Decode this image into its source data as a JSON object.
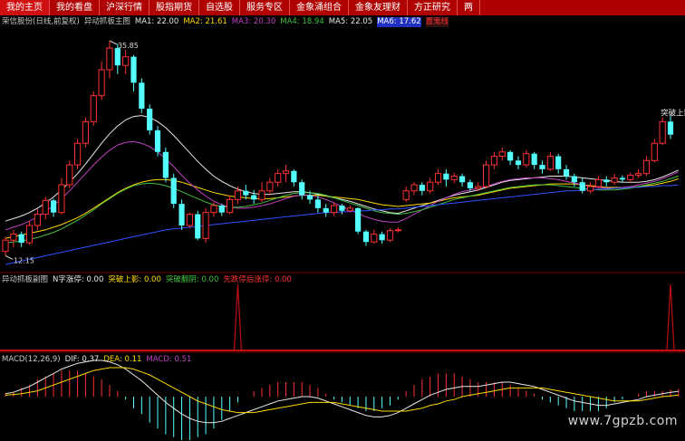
{
  "tabs": [
    "我的主页",
    "我的看盘",
    "沪深行情",
    "股指期货",
    "自选股",
    "服务专区",
    "金象涌组合",
    "金象友理财",
    "方正研究",
    "两"
  ],
  "main_legend": {
    "stock": "荣信股份(日线,前复权)",
    "indicator": "异动抓板主图",
    "ma1": "MA1: 22.00",
    "ma2": "MA2: 21.61",
    "ma3": "MA3: 20.30",
    "ma4": "MA4: 18.94",
    "ma5": "MA5: 22.05",
    "ma6": "MA6: 17.62",
    "extra": "置鬼线"
  },
  "price_high_label": "35.85",
  "price_low_label": "12.15",
  "break_label": "突破上影",
  "sub1_legend": {
    "name": "异动抓板副图",
    "n_item": "N字涨停: 0.00",
    "break_item": "突破上影: 0.00",
    "break_ok": "突破翻阴: 0.00",
    "lure": "先跌停后涨停: 0.00"
  },
  "macd_legend": {
    "name": "MACD(12,26,9)",
    "dif": "DIF: 0.37",
    "dea": "DEA: 0.11",
    "macd": "MACD: 0.51"
  },
  "watermark": "www.7gpzb.com",
  "colors": {
    "topbar": "#b00000",
    "up": "#ff3030",
    "down": "#54ffff",
    "ma_white": "#e8e8e8",
    "ma_yellow": "#ffd700",
    "ma_magenta": "#c040c0",
    "ma_green": "#40c040",
    "ma_blue": "#3050ff",
    "signal_line": "#c01010"
  },
  "candles": [
    [
      11.5,
      12.8,
      11.0,
      13.2
    ],
    [
      12.8,
      13.5,
      12.0,
      14.0
    ],
    [
      13.5,
      12.5,
      12.0,
      13.8
    ],
    [
      12.5,
      14.5,
      12.3,
      15.0
    ],
    [
      14.5,
      15.8,
      14.0,
      16.4
    ],
    [
      15.8,
      17.4,
      15.2,
      17.8
    ],
    [
      17.4,
      16.0,
      15.5,
      17.6
    ],
    [
      16.0,
      19.2,
      15.8,
      20.0
    ],
    [
      19.2,
      21.5,
      18.8,
      22.0
    ],
    [
      21.5,
      24.0,
      21.0,
      24.5
    ],
    [
      24.0,
      26.5,
      23.5,
      27.0
    ],
    [
      26.5,
      29.5,
      26.0,
      30.0
    ],
    [
      29.5,
      32.5,
      29.0,
      33.5
    ],
    [
      32.5,
      35.0,
      31.5,
      35.85
    ],
    [
      35.0,
      33.0,
      32.0,
      35.5
    ],
    [
      33.0,
      34.0,
      32.0,
      34.8
    ],
    [
      34.0,
      31.0,
      30.0,
      34.2
    ],
    [
      31.0,
      28.0,
      27.5,
      31.5
    ],
    [
      28.0,
      25.5,
      25.0,
      28.5
    ],
    [
      25.5,
      23.0,
      22.5,
      26.0
    ],
    [
      23.0,
      20.0,
      19.5,
      23.5
    ],
    [
      20.0,
      17.0,
      16.5,
      20.5
    ],
    [
      17.0,
      14.5,
      14.0,
      17.5
    ],
    [
      14.5,
      15.8,
      14.2,
      16.0
    ],
    [
      15.8,
      13.0,
      12.8,
      16.2
    ],
    [
      13.0,
      16.0,
      12.5,
      16.5
    ],
    [
      16.0,
      16.8,
      15.5,
      17.2
    ],
    [
      16.8,
      16.0,
      15.6,
      17.0
    ],
    [
      16.0,
      17.5,
      15.8,
      18.0
    ],
    [
      17.5,
      18.5,
      17.0,
      19.0
    ],
    [
      18.5,
      18.0,
      17.5,
      19.2
    ],
    [
      18.0,
      17.5,
      17.0,
      18.6
    ],
    [
      17.5,
      18.5,
      17.2,
      19.5
    ],
    [
      18.5,
      19.5,
      18.0,
      20.0
    ],
    [
      19.5,
      20.5,
      19.0,
      21.0
    ],
    [
      20.5,
      20.8,
      19.5,
      21.5
    ],
    [
      20.8,
      19.5,
      19.0,
      21.0
    ],
    [
      19.5,
      18.0,
      17.5,
      19.8
    ],
    [
      18.0,
      17.5,
      17.0,
      18.5
    ],
    [
      17.5,
      16.5,
      16.0,
      18.0
    ],
    [
      16.5,
      16.0,
      15.5,
      17.0
    ],
    [
      16.0,
      16.8,
      15.6,
      17.2
    ],
    [
      16.8,
      16.2,
      15.8,
      17.0
    ],
    [
      16.2,
      16.5,
      16.0,
      16.8
    ],
    [
      16.5,
      13.8,
      13.5,
      16.6
    ],
    [
      13.8,
      12.6,
      12.15,
      14.0
    ],
    [
      12.6,
      13.5,
      12.4,
      14.0
    ],
    [
      13.5,
      12.8,
      12.4,
      13.8
    ],
    [
      12.8,
      13.9,
      12.6,
      14.2
    ],
    [
      13.9,
      14.0,
      13.7,
      14.3
    ],
    [
      17.5,
      18.5,
      17.2,
      19.0
    ],
    [
      18.5,
      19.2,
      18.0,
      19.5
    ],
    [
      19.2,
      18.5,
      18.0,
      19.5
    ],
    [
      18.5,
      19.5,
      18.2,
      20.0
    ],
    [
      19.5,
      20.5,
      19.2,
      21.0
    ],
    [
      20.5,
      19.8,
      19.0,
      21.0
    ],
    [
      19.8,
      20.2,
      19.4,
      20.6
    ],
    [
      20.2,
      19.5,
      19.0,
      20.5
    ],
    [
      19.5,
      18.8,
      18.5,
      19.8
    ],
    [
      18.8,
      19.0,
      18.5,
      19.5
    ],
    [
      19.0,
      21.5,
      18.8,
      22.0
    ],
    [
      21.5,
      22.5,
      21.0,
      23.0
    ],
    [
      22.5,
      23.0,
      22.0,
      23.5
    ],
    [
      23.0,
      22.0,
      21.5,
      23.2
    ],
    [
      22.0,
      21.5,
      21.0,
      22.5
    ],
    [
      21.5,
      22.8,
      21.2,
      23.2
    ],
    [
      22.8,
      21.5,
      21.0,
      23.0
    ],
    [
      21.5,
      21.0,
      20.5,
      22.0
    ],
    [
      21.0,
      22.5,
      20.8,
      23.0
    ],
    [
      22.5,
      21.0,
      20.5,
      22.8
    ],
    [
      21.0,
      20.2,
      19.8,
      21.5
    ],
    [
      20.2,
      19.5,
      19.0,
      20.5
    ],
    [
      19.5,
      18.5,
      18.2,
      20.0
    ],
    [
      18.5,
      19.0,
      18.2,
      19.5
    ],
    [
      19.0,
      19.8,
      18.8,
      20.2
    ],
    [
      19.8,
      19.5,
      19.0,
      20.2
    ],
    [
      19.5,
      20.0,
      19.2,
      20.5
    ],
    [
      20.0,
      19.8,
      19.5,
      20.3
    ],
    [
      19.8,
      20.3,
      19.5,
      20.6
    ],
    [
      20.3,
      20.5,
      20.0,
      21.0
    ],
    [
      20.5,
      22.0,
      20.2,
      22.5
    ],
    [
      22.0,
      24.0,
      21.8,
      24.5
    ],
    [
      24.0,
      26.5,
      23.8,
      27.0
    ],
    [
      26.5,
      25.0,
      24.5,
      27.2
    ]
  ],
  "ma_series": {
    "white": [
      15.0,
      15.3,
      15.6,
      16.0,
      16.5,
      17.1,
      17.8,
      18.6,
      19.5,
      20.5,
      21.6,
      22.8,
      24.0,
      25.1,
      26.0,
      26.7,
      27.1,
      27.2,
      27.0,
      26.5,
      25.8,
      24.9,
      23.9,
      22.9,
      21.9,
      21.0,
      20.2,
      19.6,
      19.1,
      18.7,
      18.4,
      18.2,
      18.1,
      18.1,
      18.2,
      18.3,
      18.4,
      18.4,
      18.3,
      18.1,
      17.9,
      17.7,
      17.5,
      17.3,
      17.0,
      16.7,
      16.4,
      16.2,
      16.0,
      15.9,
      16.2,
      16.5,
      16.8,
      17.1,
      17.4,
      17.7,
      18.0,
      18.2,
      18.4,
      18.6,
      18.9,
      19.2,
      19.5,
      19.7,
      19.8,
      19.9,
      20.0,
      20.1,
      20.2,
      20.2,
      20.2,
      20.1,
      20.0,
      19.9,
      19.8,
      19.7,
      19.6,
      19.5,
      19.5,
      19.5,
      19.6,
      19.8,
      20.1,
      20.5,
      20.9
    ],
    "yellow": [
      13.0,
      13.2,
      13.4,
      13.6,
      13.8,
      14.0,
      14.3,
      14.6,
      15.0,
      15.4,
      15.9,
      16.5,
      17.1,
      17.7,
      18.3,
      18.8,
      19.2,
      19.5,
      19.7,
      19.8,
      19.8,
      19.7,
      19.5,
      19.2,
      18.9,
      18.6,
      18.3,
      18.1,
      17.9,
      17.8,
      17.7,
      17.6,
      17.6,
      17.6,
      17.7,
      17.8,
      17.9,
      18.0,
      18.0,
      18.0,
      17.9,
      17.8,
      17.7,
      17.6,
      17.5,
      17.3,
      17.1,
      16.9,
      16.8,
      16.7,
      16.8,
      16.9,
      17.0,
      17.1,
      17.3,
      17.5,
      17.7,
      17.8,
      17.9,
      18.0,
      18.2,
      18.4,
      18.6,
      18.8,
      18.9,
      19.0,
      19.1,
      19.2,
      19.3,
      19.3,
      19.3,
      19.3,
      19.2,
      19.1,
      19.0,
      18.9,
      18.9,
      18.9,
      18.9,
      19.0,
      19.1,
      19.2,
      19.4,
      19.6,
      19.9
    ],
    "magenta": [
      14.0,
      14.3,
      14.6,
      15.0,
      15.5,
      16.1,
      16.8,
      17.6,
      18.5,
      19.5,
      20.5,
      21.5,
      22.4,
      23.2,
      23.8,
      24.1,
      24.2,
      24.0,
      23.6,
      23.0,
      22.2,
      21.3,
      20.3,
      19.4,
      18.6,
      17.9,
      17.3,
      16.9,
      16.6,
      16.5,
      16.5,
      16.6,
      16.8,
      17.0,
      17.3,
      17.6,
      17.9,
      18.0,
      18.0,
      17.8,
      17.5,
      17.1,
      16.7,
      16.3,
      15.9,
      15.5,
      15.2,
      15.0,
      14.9,
      14.9,
      15.3,
      15.8,
      16.3,
      16.8,
      17.3,
      17.7,
      18.1,
      18.4,
      18.6,
      18.8,
      19.0,
      19.3,
      19.6,
      19.8,
      19.9,
      20.0,
      20.0,
      20.0,
      19.9,
      19.8,
      19.6,
      19.4,
      19.2,
      19.0,
      18.9,
      18.8,
      18.8,
      18.9,
      19.0,
      19.2,
      19.4,
      19.6,
      19.9,
      20.3,
      20.7
    ],
    "green": [
      12.5,
      12.6,
      12.7,
      12.9,
      13.1,
      13.4,
      13.7,
      14.1,
      14.6,
      15.1,
      15.7,
      16.3,
      17.0,
      17.6,
      18.2,
      18.7,
      19.1,
      19.3,
      19.4,
      19.3,
      19.1,
      18.8,
      18.4,
      18.0,
      17.6,
      17.2,
      16.9,
      16.7,
      16.6,
      16.6,
      16.7,
      16.9,
      17.1,
      17.4,
      17.7,
      18.0,
      18.2,
      18.3,
      18.3,
      18.2,
      18.0,
      17.7,
      17.4,
      17.1,
      16.8,
      16.5,
      16.2,
      16.0,
      15.9,
      15.8,
      15.9,
      16.1,
      16.3,
      16.6,
      16.9,
      17.2,
      17.5,
      17.7,
      17.9,
      18.1,
      18.3,
      18.5,
      18.7,
      18.9,
      19.0,
      19.1,
      19.2,
      19.2,
      19.2,
      19.1,
      19.0,
      18.9,
      18.8,
      18.7,
      18.6,
      18.6,
      18.6,
      18.7,
      18.8,
      19.0,
      19.2,
      19.4,
      19.6,
      19.9,
      20.2
    ],
    "blue": [
      10.0,
      10.2,
      10.4,
      10.6,
      10.8,
      11.0,
      11.2,
      11.4,
      11.6,
      11.8,
      12.0,
      12.2,
      12.4,
      12.6,
      12.8,
      13.0,
      13.2,
      13.4,
      13.6,
      13.8,
      14.0,
      14.1,
      14.2,
      14.3,
      14.4,
      14.5,
      14.6,
      14.7,
      14.8,
      14.9,
      15.0,
      15.1,
      15.2,
      15.3,
      15.4,
      15.5,
      15.6,
      15.7,
      15.8,
      15.9,
      16.0,
      16.0,
      16.1,
      16.1,
      16.2,
      16.2,
      16.3,
      16.3,
      16.4,
      16.4,
      16.5,
      16.6,
      16.7,
      16.8,
      16.9,
      17.0,
      17.1,
      17.2,
      17.3,
      17.4,
      17.5,
      17.6,
      17.7,
      17.8,
      17.9,
      18.0,
      18.1,
      18.2,
      18.3,
      18.4,
      18.5,
      18.5,
      18.6,
      18.6,
      18.7,
      18.7,
      18.8,
      18.8,
      18.9,
      18.9,
      19.0,
      19.0,
      19.1,
      19.1,
      19.2
    ]
  },
  "signals": [
    {
      "index": 29,
      "value": 1
    },
    {
      "index": 83,
      "value": 1
    }
  ],
  "macd": {
    "dif": [
      0.2,
      0.3,
      0.5,
      0.7,
      1.0,
      1.3,
      1.6,
      1.9,
      2.1,
      2.3,
      2.4,
      2.5,
      2.5,
      2.4,
      2.2,
      1.9,
      1.5,
      1.1,
      0.6,
      0.1,
      -0.4,
      -0.8,
      -1.2,
      -1.5,
      -1.7,
      -1.8,
      -1.8,
      -1.7,
      -1.5,
      -1.3,
      -1.1,
      -0.9,
      -0.7,
      -0.5,
      -0.3,
      -0.2,
      -0.1,
      0.0,
      0.0,
      -0.1,
      -0.3,
      -0.5,
      -0.7,
      -0.9,
      -1.1,
      -1.3,
      -1.4,
      -1.4,
      -1.3,
      -1.1,
      -0.8,
      -0.5,
      -0.2,
      0.1,
      0.3,
      0.5,
      0.6,
      0.7,
      0.7,
      0.7,
      0.8,
      0.9,
      1.0,
      1.0,
      0.9,
      0.8,
      0.7,
      0.5,
      0.3,
      0.1,
      -0.1,
      -0.3,
      -0.4,
      -0.5,
      -0.6,
      -0.6,
      -0.5,
      -0.4,
      -0.3,
      -0.2,
      0.0,
      0.1,
      0.2,
      0.3,
      0.37
    ],
    "dea": [
      0.1,
      0.15,
      0.2,
      0.3,
      0.4,
      0.6,
      0.8,
      1.0,
      1.2,
      1.4,
      1.6,
      1.8,
      1.9,
      2.0,
      2.0,
      2.0,
      1.9,
      1.7,
      1.5,
      1.2,
      0.9,
      0.6,
      0.3,
      0.0,
      -0.3,
      -0.5,
      -0.7,
      -0.9,
      -1.0,
      -1.1,
      -1.1,
      -1.1,
      -1.0,
      -0.9,
      -0.8,
      -0.7,
      -0.6,
      -0.5,
      -0.4,
      -0.4,
      -0.4,
      -0.4,
      -0.5,
      -0.6,
      -0.7,
      -0.8,
      -0.9,
      -1.0,
      -1.0,
      -1.0,
      -1.0,
      -0.9,
      -0.8,
      -0.6,
      -0.5,
      -0.3,
      -0.2,
      0.0,
      0.1,
      0.2,
      0.3,
      0.4,
      0.5,
      0.6,
      0.6,
      0.6,
      0.6,
      0.6,
      0.5,
      0.4,
      0.3,
      0.2,
      0.1,
      0.0,
      -0.1,
      -0.2,
      -0.3,
      -0.3,
      -0.3,
      -0.3,
      -0.2,
      -0.1,
      0.0,
      0.05,
      0.11
    ]
  }
}
